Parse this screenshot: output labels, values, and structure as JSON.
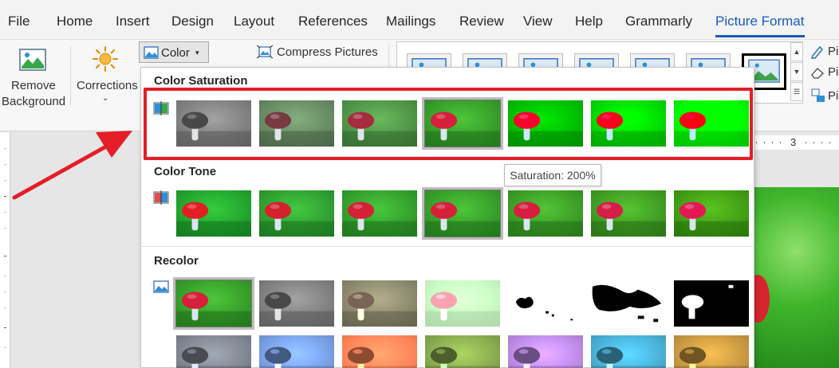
{
  "menu": {
    "tabs": [
      "File",
      "Home",
      "Insert",
      "Design",
      "Layout",
      "References",
      "Mailings",
      "Review",
      "View",
      "Help",
      "Grammarly",
      "Picture Format"
    ],
    "active_tab": "Picture Format"
  },
  "ribbon": {
    "remove_background": {
      "line1": "Remove",
      "line2": "Background"
    },
    "corrections": "Corrections",
    "color": "Color",
    "compress": "Compress Pictures",
    "side_items": [
      "Pi",
      "Pi",
      "Pi"
    ]
  },
  "panel": {
    "saturation_title": "Color Saturation",
    "tone_title": "Color Tone",
    "recolor_title": "Recolor",
    "tooltip": "Saturation: 200%",
    "saturation_levels": [
      0,
      33,
      66,
      100,
      200,
      300,
      400
    ],
    "selected_saturation_index": 3,
    "selected_tone_index": 3,
    "selected_recolor_index": 0
  },
  "ruler": {
    "mark": "3"
  },
  "colors": {
    "accent": "#185abd",
    "highlight": "#e41e26",
    "mushroom_red": "#d8232e",
    "grass_green": "#3aa02a"
  }
}
